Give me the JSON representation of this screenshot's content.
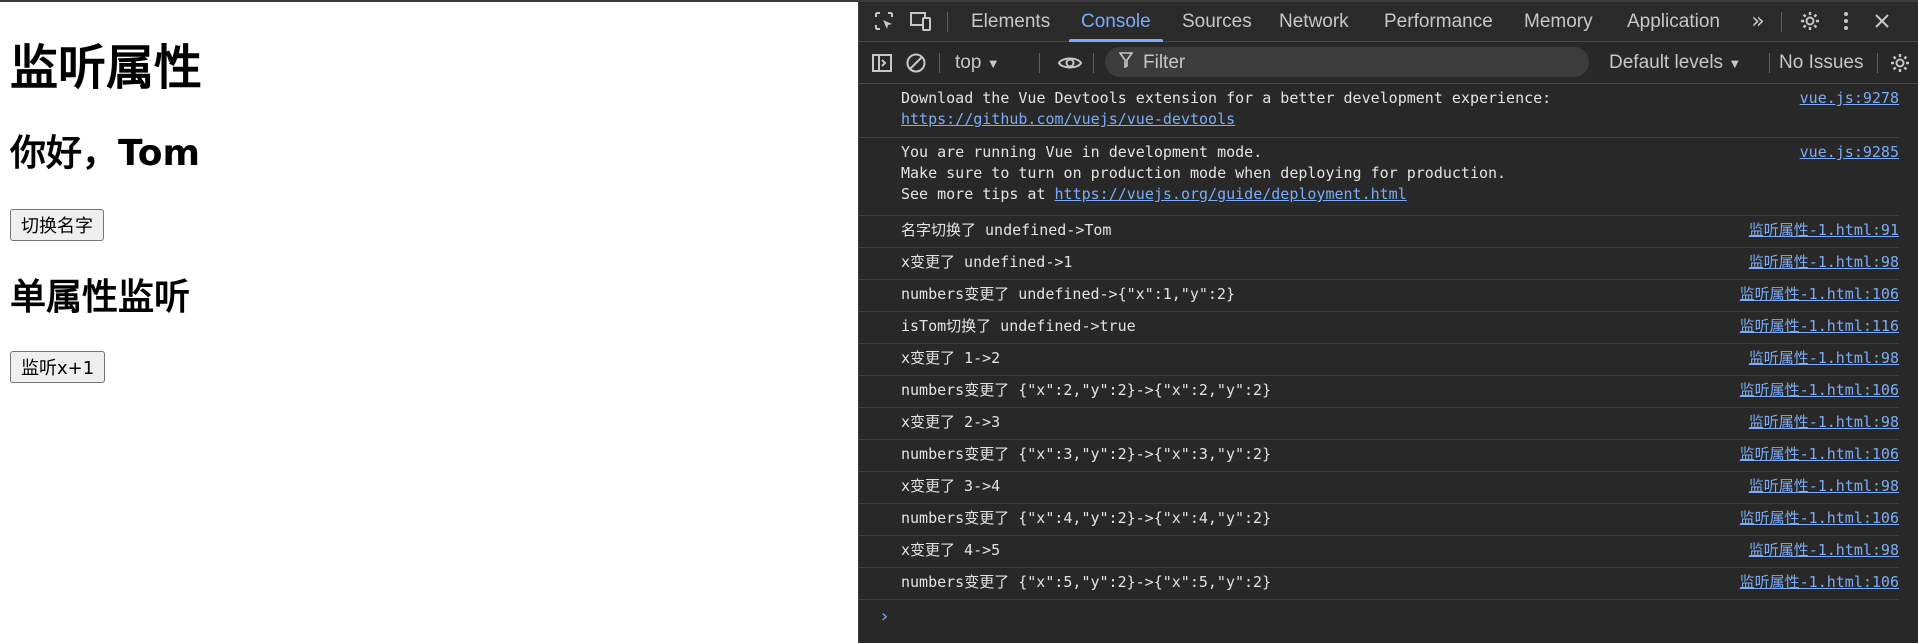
{
  "page": {
    "title": "监听属性",
    "greeting": "你好，Tom",
    "switch_button": "切换名字",
    "subtitle": "单属性监听",
    "increment_button": "监听x+1"
  },
  "devtools": {
    "tabs": [
      "Elements",
      "Console",
      "Sources",
      "Network",
      "Performance",
      "Memory",
      "Application"
    ],
    "active_tab": "Console",
    "toolbar": {
      "context": "top",
      "filter_placeholder": "Filter",
      "levels": "Default levels",
      "issues": "No Issues"
    },
    "icons": {
      "inspect": "inspect-element-icon",
      "device": "device-toggle-icon",
      "more_tabs": "more-tabs-icon",
      "settings": "gear-icon",
      "menu": "kebab-menu-icon",
      "close": "close-icon",
      "sidebar": "sidebar-toggle-icon",
      "clear": "clear-console-icon",
      "eye": "eye-icon",
      "filter": "filter-icon",
      "console_settings": "console-gear-icon",
      "prompt": "prompt-chevron-icon"
    },
    "colors": {
      "accent": "#7cacf8",
      "background": "#282828",
      "text": "#e3e3e3"
    },
    "messages": [
      {
        "line1": "Download the Vue Devtools extension for a better development experience:",
        "link": "https://github.com/vuejs/vue-devtools",
        "source": "vue.js:9278"
      },
      {
        "line1": "You are running Vue in development mode.",
        "line2": "Make sure to turn on production mode when deploying for production.",
        "line3_prefix": "See more tips at ",
        "link": "https://vuejs.org/guide/deployment.html",
        "source": "vue.js:9285"
      },
      {
        "text": "名字切换了 undefined->Tom",
        "source": "监听属性-1.html:91"
      },
      {
        "text": "x变更了 undefined->1",
        "source": "监听属性-1.html:98"
      },
      {
        "text": "numbers变更了 undefined->{\"x\":1,\"y\":2}",
        "source": "监听属性-1.html:106"
      },
      {
        "text": "isTom切换了 undefined->true",
        "source": "监听属性-1.html:116"
      },
      {
        "text": "x变更了 1->2",
        "source": "监听属性-1.html:98"
      },
      {
        "text": "numbers变更了 {\"x\":2,\"y\":2}->{\"x\":2,\"y\":2}",
        "source": "监听属性-1.html:106"
      },
      {
        "text": "x变更了 2->3",
        "source": "监听属性-1.html:98"
      },
      {
        "text": "numbers变更了 {\"x\":3,\"y\":2}->{\"x\":3,\"y\":2}",
        "source": "监听属性-1.html:106"
      },
      {
        "text": "x变更了 3->4",
        "source": "监听属性-1.html:98"
      },
      {
        "text": "numbers变更了 {\"x\":4,\"y\":2}->{\"x\":4,\"y\":2}",
        "source": "监听属性-1.html:106"
      },
      {
        "text": "x变更了 4->5",
        "source": "监听属性-1.html:98"
      },
      {
        "text": "numbers变更了 {\"x\":5,\"y\":2}->{\"x\":5,\"y\":2}",
        "source": "监听属性-1.html:106"
      }
    ]
  }
}
